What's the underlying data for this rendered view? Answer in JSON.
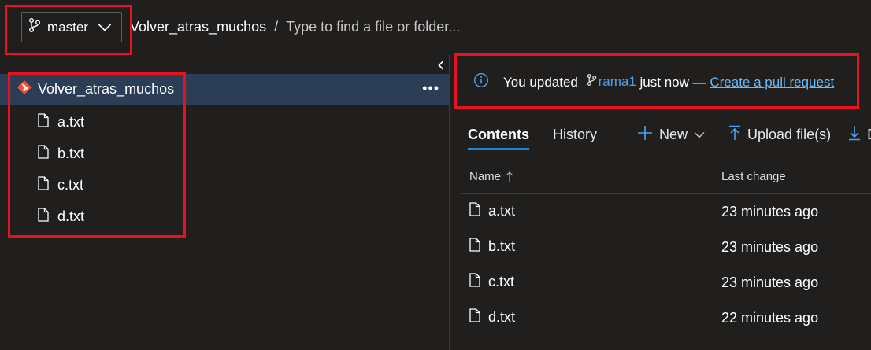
{
  "header": {
    "branch_label": "master",
    "repo_name": "Volver_atras_muchos",
    "path_separator": "/",
    "search_placeholder": "Type to find a file or folder..."
  },
  "tree": {
    "root_label": "Volver_atras_muchos",
    "more_label": "•••",
    "files": [
      {
        "name": "a.txt"
      },
      {
        "name": "b.txt"
      },
      {
        "name": "c.txt"
      },
      {
        "name": "d.txt"
      }
    ]
  },
  "banner": {
    "prefix": "You updated",
    "branch": "rama1",
    "middle": "just now —",
    "link": "Create a pull request"
  },
  "tabs": {
    "contents": "Contents",
    "history": "History"
  },
  "actions": {
    "new": "New",
    "upload": "Upload file(s)",
    "download_truncated": "D"
  },
  "list": {
    "columns": {
      "name": "Name",
      "last_change": "Last change"
    },
    "rows": [
      {
        "name": "a.txt",
        "time": "23 minutes ago"
      },
      {
        "name": "b.txt",
        "time": "23 minutes ago"
      },
      {
        "name": "c.txt",
        "time": "23 minutes ago"
      },
      {
        "name": "d.txt",
        "time": "22 minutes ago"
      }
    ]
  },
  "icons": {
    "branch": "branch-icon",
    "chevron": "chevron-down-icon",
    "git_repo": "git-logo-icon",
    "file": "file-icon",
    "info": "info-icon",
    "plus": "plus-icon",
    "upload": "upload-icon",
    "download": "download-icon",
    "sort": "sort-arrow-icon",
    "collapse": "chevron-left-icon"
  },
  "colors": {
    "background": "#201f1e",
    "selected_row": "#2b3e55",
    "accent": "#1a86d9",
    "link": "#6cb8f6",
    "highlight_box": "#e81123",
    "git_logo": "#f1502f"
  }
}
